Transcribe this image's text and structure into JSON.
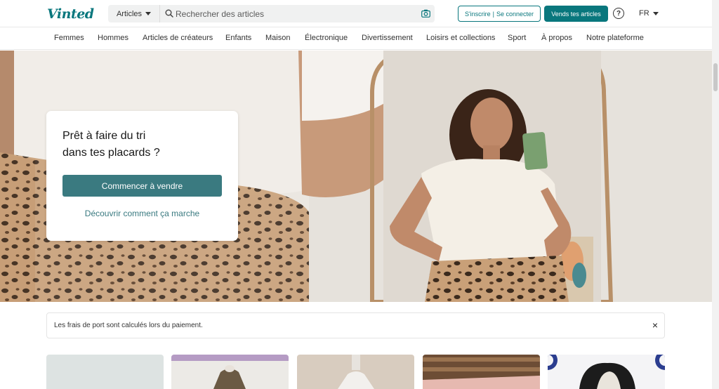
{
  "header": {
    "logo": "Vinted",
    "search_category": "Articles",
    "search_placeholder": "Rechercher des articles",
    "signup_label": "S'inscrire",
    "separator": "|",
    "login_label": "Se connecter",
    "sell_label": "Vends tes articles",
    "help_symbol": "?",
    "language": "FR"
  },
  "nav": {
    "items": [
      {
        "label": "Femmes"
      },
      {
        "label": "Hommes"
      },
      {
        "label": "Articles de créateurs"
      },
      {
        "label": "Enfants"
      },
      {
        "label": "Maison"
      },
      {
        "label": "Électronique"
      },
      {
        "label": "Divertissement"
      },
      {
        "label": "Loisirs et collections"
      },
      {
        "label": "Sport"
      },
      {
        "label": "À propos"
      },
      {
        "label": "Notre plateforme"
      }
    ]
  },
  "hero": {
    "title_line1": "Prêt à faire du tri",
    "title_line2": "dans tes placards ?",
    "cta_label": "Commencer à vendre",
    "link_label": "Découvrir comment ça marche"
  },
  "notice": {
    "text": "Les frais de port sont calculés lors du paiement.",
    "close_symbol": "×"
  },
  "colors": {
    "brand": "#09777d",
    "cta": "#3a7a80"
  },
  "icons": [
    "search-icon",
    "camera-icon",
    "help-icon",
    "chevron-down-icon",
    "close-icon"
  ]
}
